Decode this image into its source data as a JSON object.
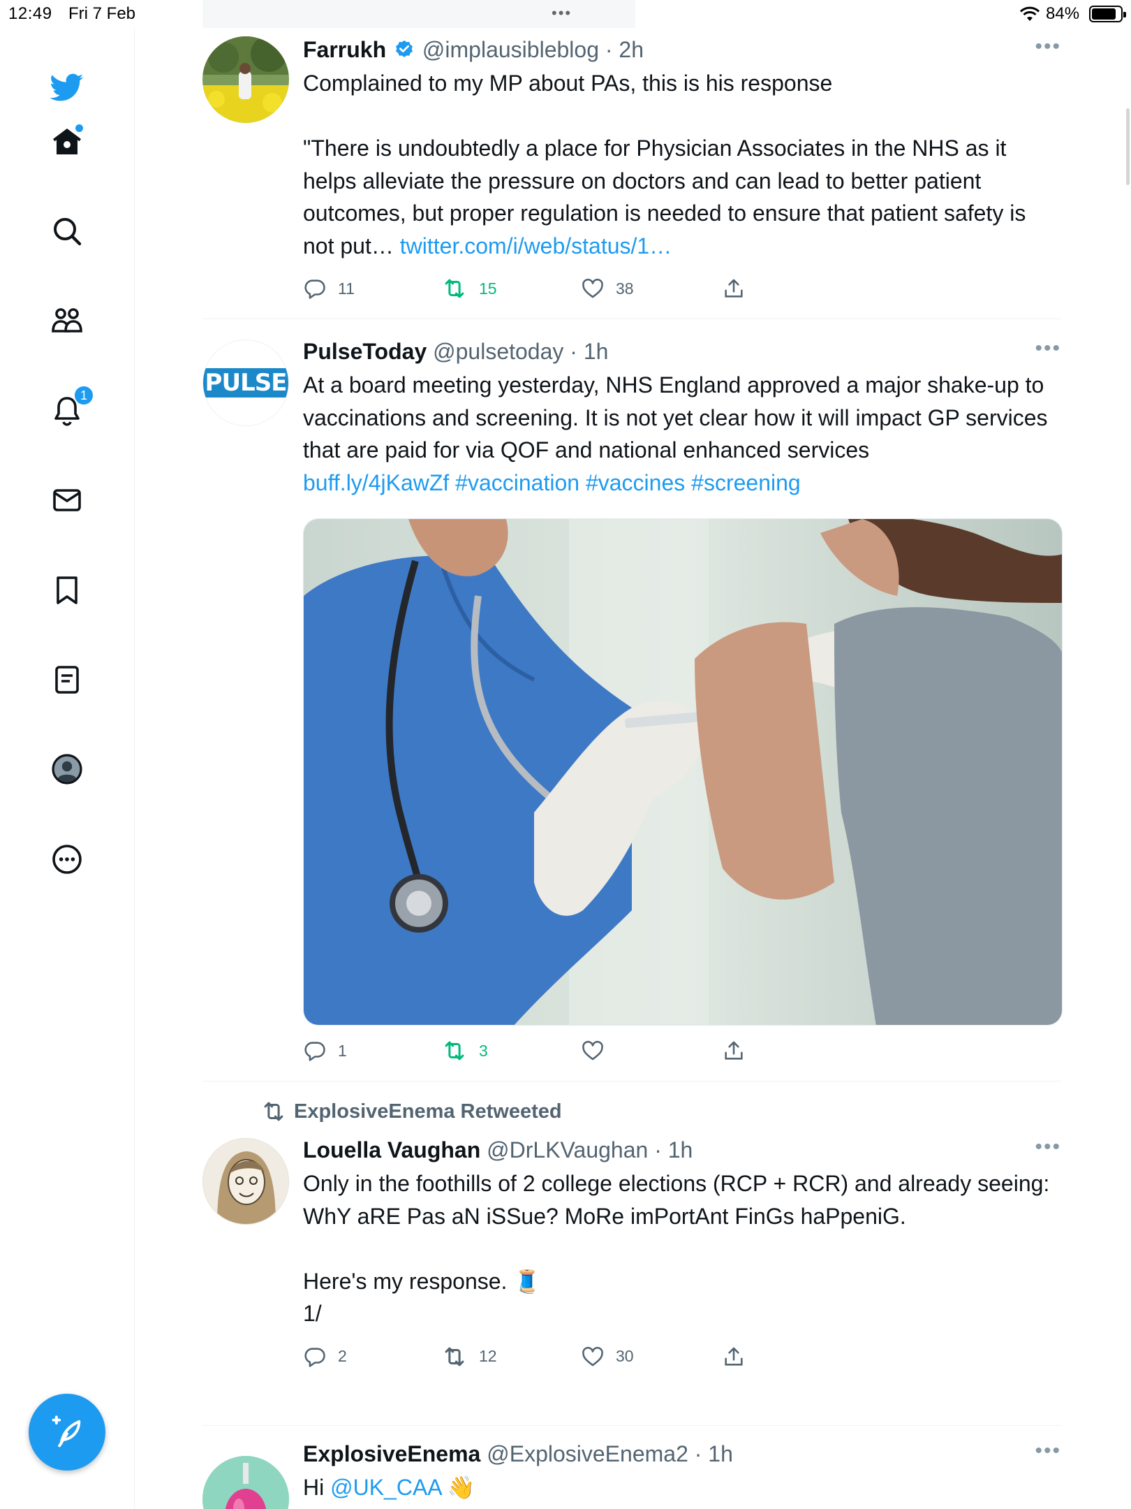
{
  "status_bar": {
    "time": "12:49",
    "date": "Fri 7 Feb",
    "center_dots": "•••",
    "battery_percent": "84%",
    "battery_level": 0.84
  },
  "sidebar": {
    "items": [
      {
        "name": "twitter-logo-icon"
      },
      {
        "name": "home-icon",
        "has_new_dot": true
      },
      {
        "name": "search-icon"
      },
      {
        "name": "communities-icon"
      },
      {
        "name": "notifications-icon",
        "badge": "1"
      },
      {
        "name": "messages-icon"
      },
      {
        "name": "bookmarks-icon"
      },
      {
        "name": "lists-icon"
      },
      {
        "name": "profile-icon"
      },
      {
        "name": "more-icon"
      }
    ],
    "compose_icon": "compose-feather-icon"
  },
  "colors": {
    "accent": "#1d9bf0",
    "retweet_green": "#00ba7c",
    "secondary_text": "#536471",
    "divider": "#eff3f4"
  },
  "tweets": [
    {
      "name": "Farrukh",
      "verified": true,
      "handle": "@implausibleblog",
      "time": "· 2h",
      "more": "•••",
      "text": "Complained to my MP about PAs, this is his response\n\n\"There is undoubtedly a place for Physician Associates in the NHS as it helps alleviate the pressure on doctors and can lead to better patient outcomes, but proper regulation is needed to ensure that patient safety is not put… ",
      "link": "twitter.com/i/web/status/1…",
      "replies": "11",
      "retweets": "15",
      "likes": "38",
      "retweeted_by_me": true
    },
    {
      "name": "PulseToday",
      "handle": "@pulsetoday",
      "time": "· 1h",
      "more": "•••",
      "avatar_text": "PULSE",
      "text": "At a board meeting yesterday, NHS England approved a major shake-up to vaccinations and screening. It is not yet clear how it will impact GP services that are paid for via QOF and national enhanced services\n",
      "links": [
        "buff.ly/4jKawZf",
        "#vaccination",
        "#vaccines",
        "#screening"
      ],
      "replies": "1",
      "retweets": "3",
      "likes": "",
      "retweeted_by_me": true
    },
    {
      "retweeted_by": "ExplosiveEnema Retweeted",
      "name": "Louella Vaughan",
      "handle": "@DrLKVaughan",
      "time": "· 1h",
      "more": "•••",
      "text": "Only in the foothills of 2 college elections (RCP + RCR) and already seeing:\nWhY aRE Pas aN iSSue? MoRe imPortAnt FinGs haPpeniG.\n\nHere's my response. 🧵\n1/",
      "replies": "2",
      "retweets": "12",
      "likes": "30"
    },
    {
      "name": "ExplosiveEnema",
      "handle": "@ExplosiveEnema2",
      "time": "· 1h",
      "more": "•••",
      "text_prefix": "Hi ",
      "mention": "@UK_CAA",
      "emoji": "👋"
    }
  ]
}
